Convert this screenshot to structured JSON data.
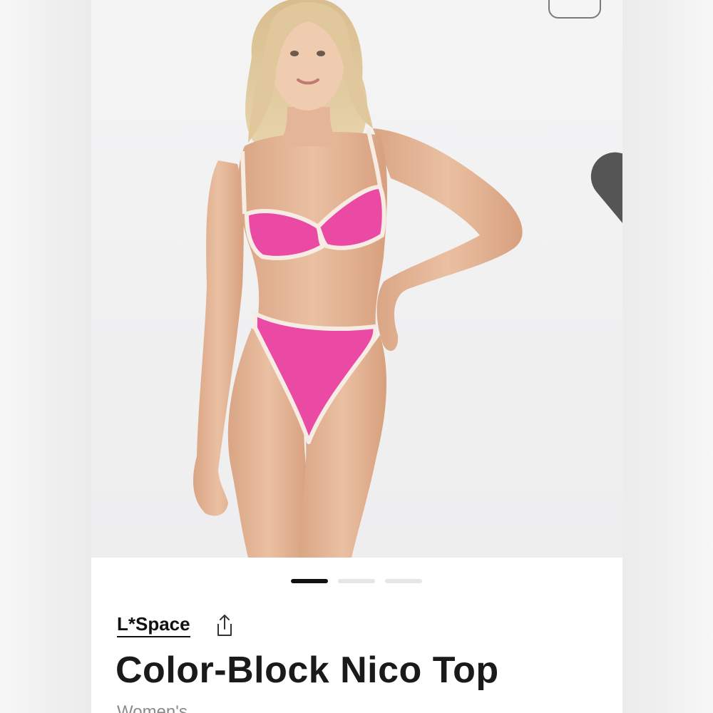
{
  "product": {
    "brand": "L*Space",
    "title": "Color-Block Nico Top",
    "category": "Women's"
  },
  "gallery": {
    "image_count": 3,
    "active_index": 0
  },
  "icons": {
    "share": "share-icon",
    "corner": "expand-icon"
  },
  "colors": {
    "swimsuit": "#ea4aa4",
    "piping": "#f6ece4",
    "text": "#111111",
    "subtext": "#8a8a8a"
  }
}
